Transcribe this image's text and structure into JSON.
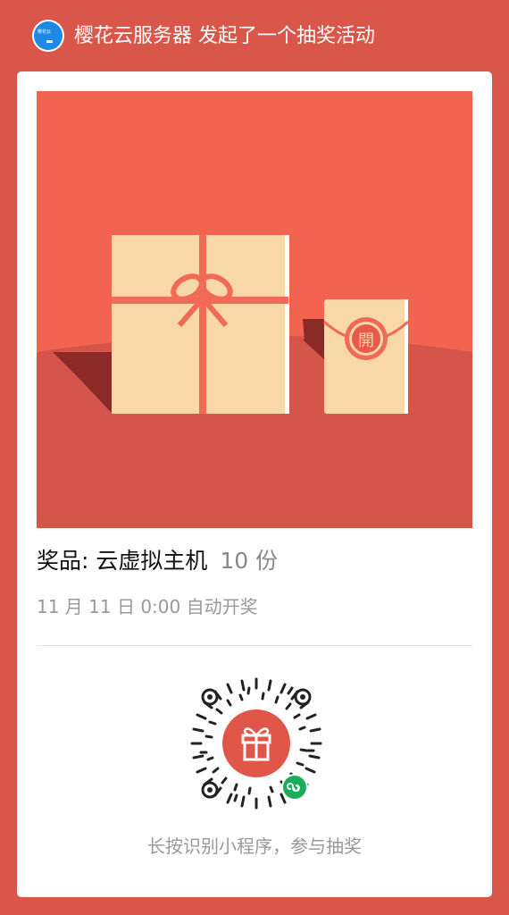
{
  "header": {
    "title": "樱花云服务器 发起了一个抽奖活动",
    "avatar_text": "樱花云"
  },
  "hero": {
    "envelope_char": "開"
  },
  "prize": {
    "name": "奖品: 云虚拟主机",
    "count": "10 份"
  },
  "draw_time": "11 月 11 日 0:00 自动开奖",
  "qr": {
    "hint": "长按识别小程序，参与抽奖",
    "center_icon": "gift-icon",
    "badge_icon": "mini-program-icon"
  },
  "colors": {
    "background": "#D9564A",
    "hero_bg": "#F26450",
    "hero_floor": "#D4564A",
    "box": "#F8D8A8",
    "ribbon": "#F06A55",
    "accent_green": "#1AAD5A"
  }
}
